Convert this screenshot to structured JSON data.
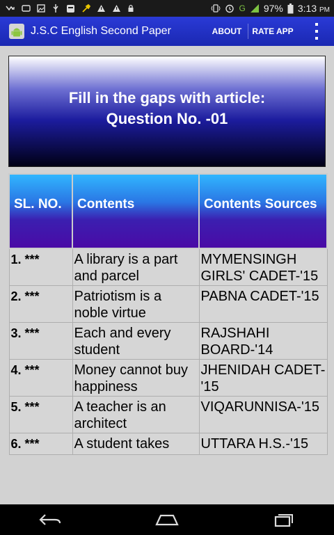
{
  "status_bar": {
    "battery": "97%",
    "time": "3:13",
    "time_suffix": "PM",
    "network": "G",
    "icons": [
      "missed-call-icon",
      "message-icon",
      "image-icon",
      "usb-icon",
      "app-icon",
      "wrench-icon",
      "warning-icon",
      "warning-icon",
      "lock-icon",
      "vibrate-icon",
      "alarm-icon",
      "signal-icon",
      "battery-icon"
    ]
  },
  "action_bar": {
    "title": "J.S.C English Second Paper",
    "about_label": "ABOUT",
    "rate_label": "RATE APP",
    "icon": "android-icon",
    "overflow_icon": "overflow-menu-icon"
  },
  "heading": {
    "line1": "Fill in the gaps with article:",
    "line2": "Question No. -01"
  },
  "table": {
    "headers": [
      "SL. NO.",
      "Contents",
      "Contents Sources"
    ],
    "rows": [
      {
        "sl": "1. ***",
        "content": "A library is a part and parcel",
        "source": "MYMENSINGH GIRLS' CADET-'15"
      },
      {
        "sl": "2. ***",
        "content": "Patriotism is a noble virtue",
        "source": "PABNA CADET-'15"
      },
      {
        "sl": "3. ***",
        "content": "Each and every student",
        "source": "RAJSHAHI BOARD-'14"
      },
      {
        "sl": "4. ***",
        "content": "Money cannot buy happiness",
        "source": "JHENIDAH CADET-'15"
      },
      {
        "sl": "5. ***",
        "content": "A teacher is an architect",
        "source": "VIQARUNNISA-'15"
      },
      {
        "sl": "6. ***",
        "content": "A student takes",
        "source": "UTTARA H.S.-'15"
      }
    ]
  },
  "nav_bar": {
    "icons": [
      "back-icon",
      "home-icon",
      "recent-apps-icon"
    ]
  }
}
